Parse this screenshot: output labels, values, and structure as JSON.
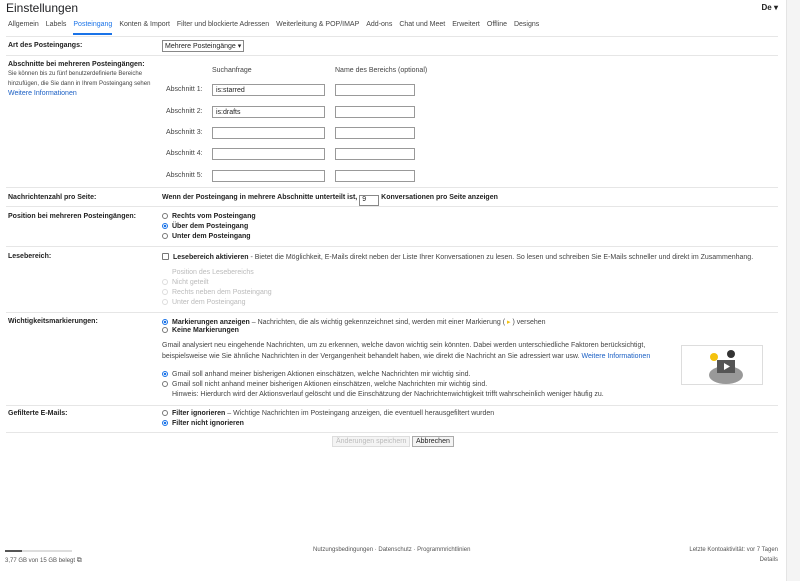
{
  "header": {
    "title": "Einstellungen",
    "account": "De ▾"
  },
  "tabs": [
    "Allgemein",
    "Labels",
    "Posteingang",
    "Konten & Import",
    "Filter und blockierte Adressen",
    "Weiterleitung & POP/IMAP",
    "Add-ons",
    "Chat und Meet",
    "Erweitert",
    "Offline",
    "Designs"
  ],
  "inbox_type": {
    "label": "Art des Posteingangs:",
    "value": "Mehrere Posteingänge ▾"
  },
  "sections": {
    "label": "Abschnitte bei mehreren Posteingängen:",
    "desc1": "Sie können bis zu fünf benutzerdefinierte Bereiche",
    "desc2": "hinzufügen, die Sie dann in Ihrem Posteingang sehen",
    "link": "Weitere Informationen",
    "col_query": "Suchanfrage",
    "col_name": "Name des Bereichs (optional)",
    "rows": [
      {
        "label": "Abschnitt 1:",
        "query": "is:starred",
        "name": ""
      },
      {
        "label": "Abschnitt 2:",
        "query": "is:drafts",
        "name": ""
      },
      {
        "label": "Abschnitt 3:",
        "query": "",
        "name": ""
      },
      {
        "label": "Abschnitt 4:",
        "query": "",
        "name": ""
      },
      {
        "label": "Abschnitt 5:",
        "query": "",
        "name": ""
      }
    ]
  },
  "page_size": {
    "label": "Nachrichtenzahl pro Seite:",
    "pre": "Wenn der Posteingang in mehrere Abschnitte unterteilt ist,",
    "value": "9",
    "post": "Konversationen pro Seite anzeigen"
  },
  "position": {
    "label": "Position bei mehreren Posteingängen:",
    "options": [
      "Rechts vom Posteingang",
      "Über dem Posteingang",
      "Unter dem Posteingang"
    ],
    "selected": 1
  },
  "reading": {
    "label": "Lesebereich:",
    "checkbox": "Lesebereich aktivieren",
    "desc": " - Bietet die Möglichkeit, E-Mails direkt neben der Liste Ihrer Konversationen zu lesen. So lesen und schreiben Sie E-Mails schneller und direkt im Zusammenhang.",
    "sub": "Position des Lesebereichs",
    "options": [
      "Nicht geteilt",
      "Rechts neben dem Posteingang",
      "Unter dem Posteingang"
    ]
  },
  "importance": {
    "label": "Wichtigkeitsmarkierungen:",
    "opt1": "Markierungen anzeigen",
    "opt1_desc": " – Nachrichten, die als wichtig gekennzeichnet sind, werden mit einer Markierung (",
    "opt1_end": ") versehen",
    "opt2": "Keine Markierungen",
    "para1": "Gmail analysiert neu eingehende Nachrichten, um zu erkennen, welche davon wichtig sein könnten. Dabei werden unterschiedliche Faktoren berücksichtigt,",
    "para2": "beispielsweise wie Sie ähnliche Nachrichten in der Vergangenheit behandelt haben, wie direkt die Nachricht an Sie adressiert war usw.",
    "link": "Weitere Informationen",
    "r1": "Gmail soll anhand meiner bisherigen Aktionen einschätzen, welche Nachrichten mir wichtig sind.",
    "r2": "Gmail soll nicht anhand meiner bisherigen Aktionen einschätzen, welche Nachrichten mir wichtig sind.",
    "hint": "Hinweis: Hierdurch wird der Aktionsverlauf gelöscht und die Einschätzung der Nachrichtenwichtigkeit trifft wahrscheinlich weniger häufig zu."
  },
  "filtered": {
    "label": "Gefilterte E-Mails:",
    "opt1": "Filter ignorieren",
    "opt1_desc": " – Wichtige Nachrichten im Posteingang anzeigen, die eventuell herausgefiltert wurden",
    "opt2": "Filter nicht ignorieren"
  },
  "buttons": {
    "save": "Änderungen speichern",
    "cancel": "Abbrechen"
  },
  "footer": {
    "storage": "3,77 GB von 15 GB belegt",
    "storage_fraction": 0.25,
    "links": "Nutzungsbedingungen · Datenschutz · Programmrichtlinien",
    "activity": "Letzte Kontoaktivität: vor 7 Tagen",
    "details": "Details"
  }
}
